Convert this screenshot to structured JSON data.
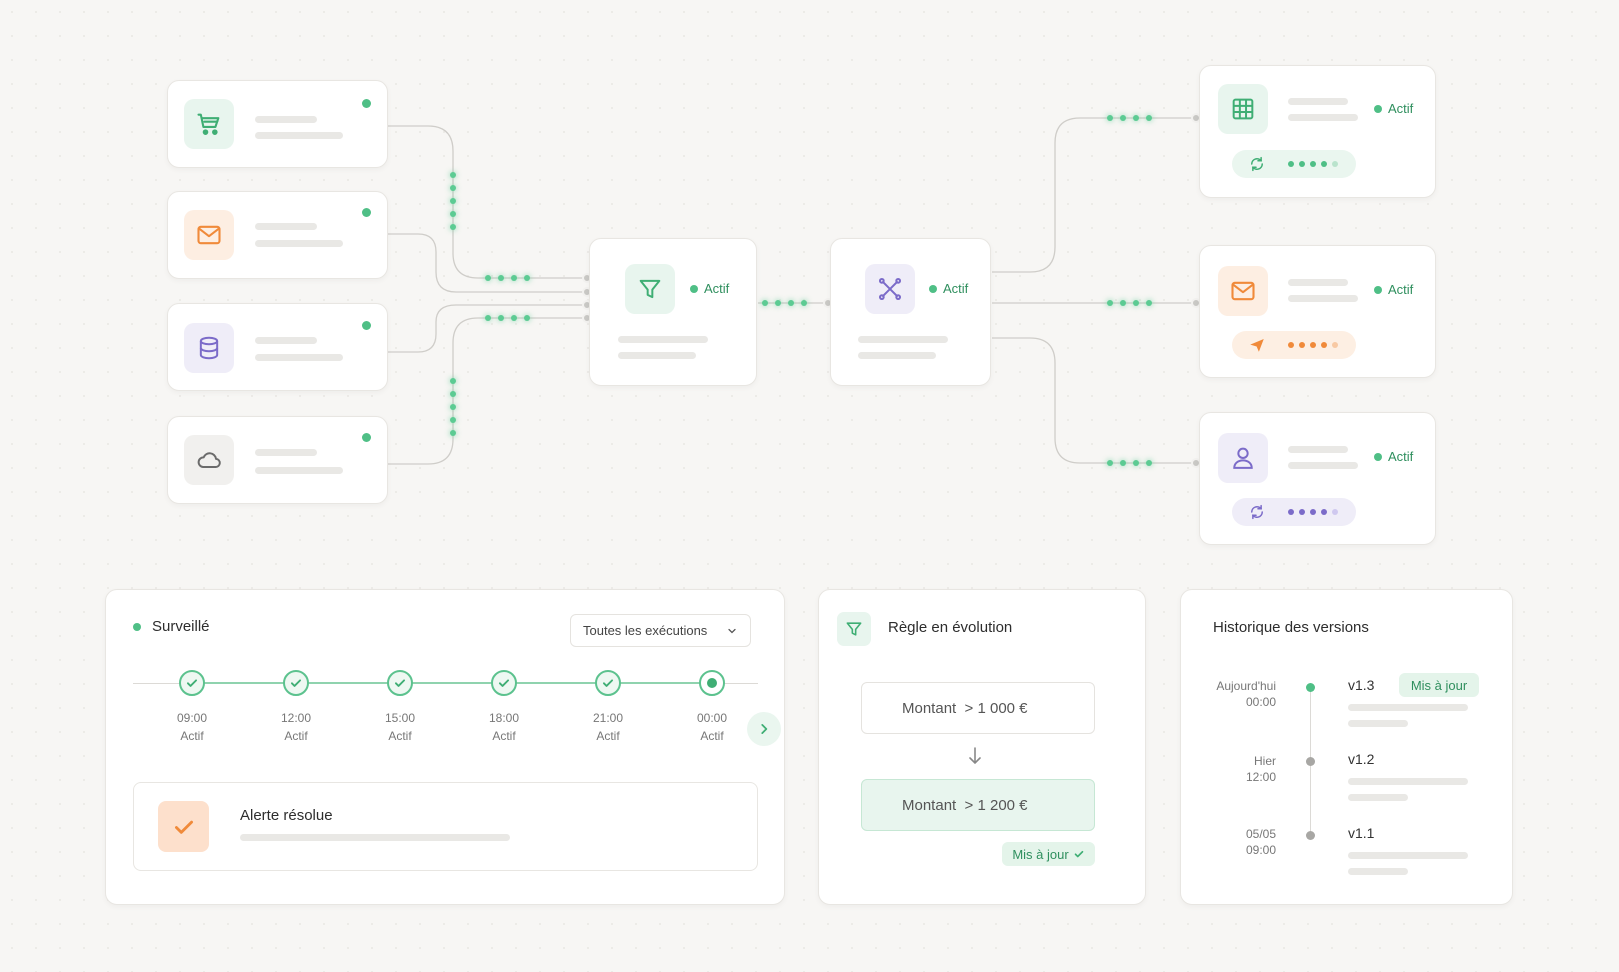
{
  "status_label": "Actif",
  "colors": {
    "green": "#4fbf86",
    "orange": "#f08a3a",
    "purple": "#7b6bc9",
    "gray": "#6b6b6b"
  },
  "sources": [
    {
      "icon": "cart-icon"
    },
    {
      "icon": "mail-icon"
    },
    {
      "icon": "database-icon"
    },
    {
      "icon": "cloud-icon"
    }
  ],
  "processors": [
    {
      "icon": "filter-icon",
      "status": "Actif"
    },
    {
      "icon": "split-icon",
      "status": "Actif"
    }
  ],
  "destinations": [
    {
      "icon": "grid-icon",
      "status": "Actif",
      "pill_icon": "refresh-icon"
    },
    {
      "icon": "mail-icon",
      "status": "Actif",
      "pill_icon": "send-icon"
    },
    {
      "icon": "user-icon",
      "status": "Actif",
      "pill_icon": "refresh-icon"
    }
  ],
  "monitor": {
    "title": "Surveillé",
    "filter": "Toutes les exécutions",
    "runs": [
      {
        "time": "09:00",
        "status": "Actif"
      },
      {
        "time": "12:00",
        "status": "Actif"
      },
      {
        "time": "15:00",
        "status": "Actif"
      },
      {
        "time": "18:00",
        "status": "Actif"
      },
      {
        "time": "21:00",
        "status": "Actif"
      },
      {
        "time": "00:00",
        "status": "Actif"
      }
    ],
    "alert": "Alerte résolue"
  },
  "rule": {
    "title": "Règle en évolution",
    "old_rule": "Montant  > 1 000 €",
    "new_rule": "Montant  > 1 200 €",
    "badge": "Mis à jour"
  },
  "history": {
    "title": "Historique des versions",
    "versions": [
      {
        "date": "Aujourd'hui",
        "time": "00:00",
        "version": "v1.3",
        "badge": "Mis à jour"
      },
      {
        "date": "Hier",
        "time": "12:00",
        "version": "v1.2"
      },
      {
        "date": "05/05",
        "time": "09:00",
        "version": "v1.1"
      }
    ]
  }
}
